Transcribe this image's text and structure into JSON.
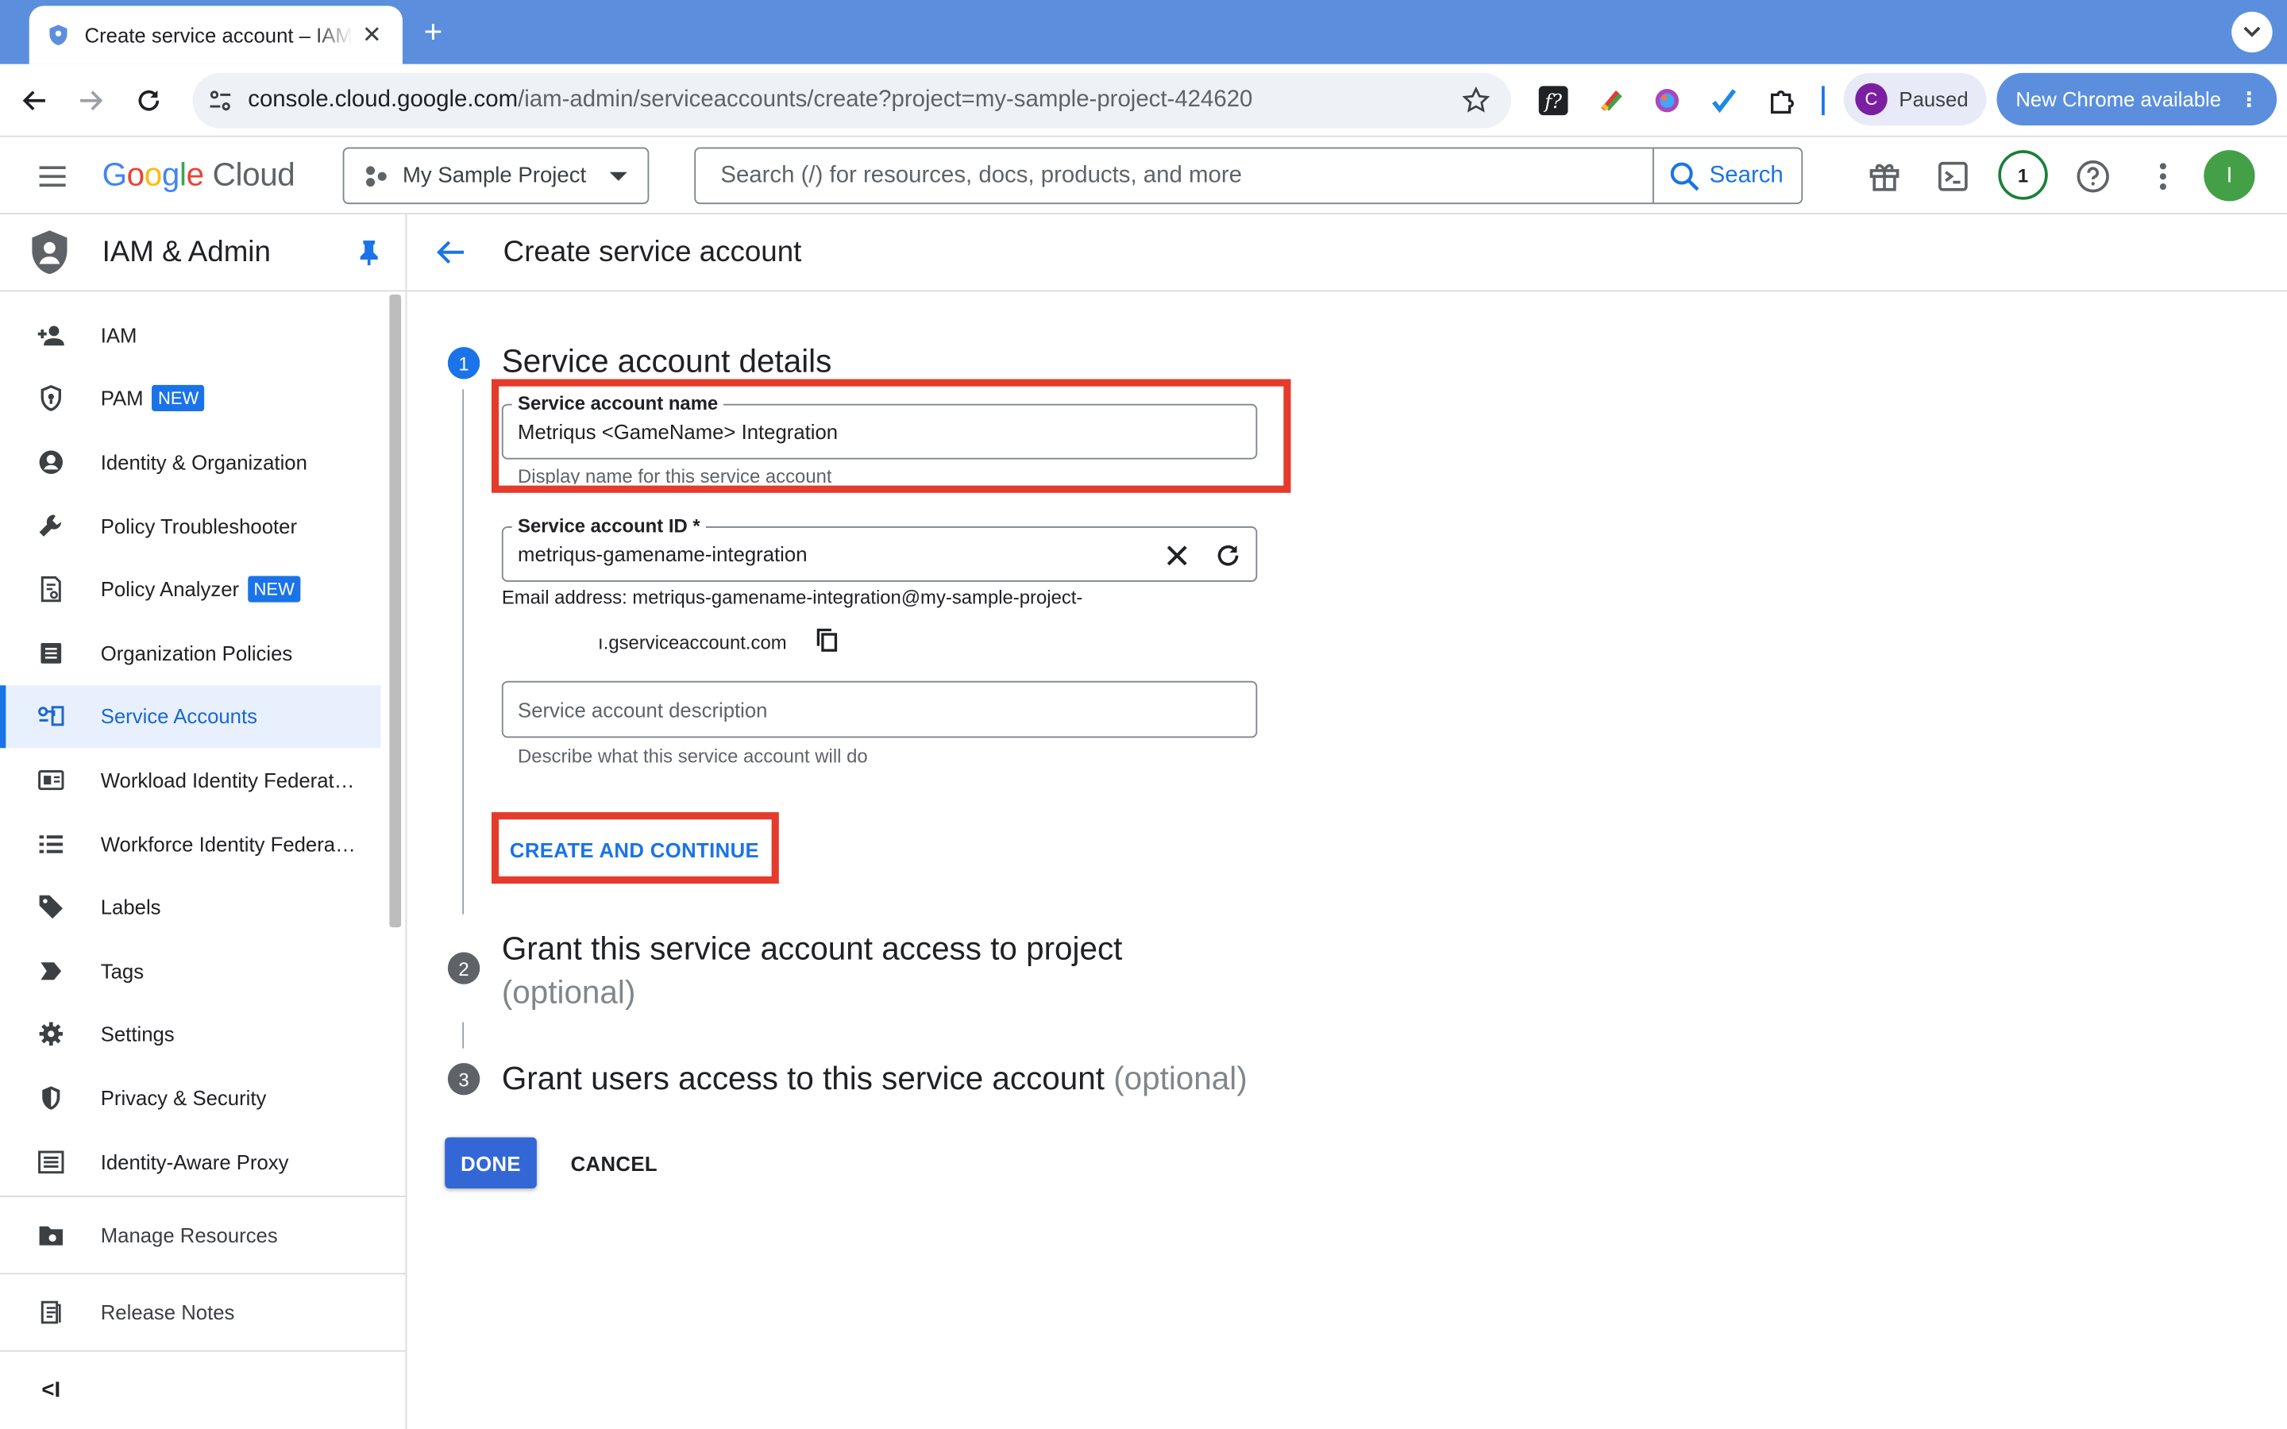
{
  "browser": {
    "tab_title": "Create service account – IAM & Admin",
    "url_host": "console.cloud.google.com",
    "url_path": "/iam-admin/serviceaccounts/create?project=my-sample-project-424620",
    "profile_initial": "C",
    "profile_label": "Paused",
    "update_label": "New Chrome available"
  },
  "header": {
    "logo_google": [
      "G",
      "o",
      "o",
      "g",
      "l",
      "e"
    ],
    "logo_cloud": "Cloud",
    "project_name": "My Sample Project",
    "search_placeholder": "Search (/) for resources, docs, products, and more",
    "search_button": "Search",
    "notification_count": "1",
    "user_initial": "I"
  },
  "sidebar": {
    "title": "IAM & Admin",
    "items": [
      {
        "label": "IAM",
        "icon": "person-add-icon"
      },
      {
        "label": "PAM",
        "badge": "NEW",
        "icon": "shield-key-icon"
      },
      {
        "label": "Identity & Organization",
        "icon": "account-circle-icon"
      },
      {
        "label": "Policy Troubleshooter",
        "icon": "wrench-icon"
      },
      {
        "label": "Policy Analyzer",
        "badge": "NEW",
        "icon": "document-search-icon"
      },
      {
        "label": "Organization Policies",
        "icon": "list-document-icon"
      },
      {
        "label": "Service Accounts",
        "icon": "service-account-icon",
        "active": true
      },
      {
        "label": "Workload Identity Federat…",
        "icon": "id-card-icon"
      },
      {
        "label": "Workforce Identity Federa…",
        "icon": "list-icon"
      },
      {
        "label": "Labels",
        "icon": "label-icon"
      },
      {
        "label": "Tags",
        "icon": "tag-icon"
      },
      {
        "label": "Settings",
        "icon": "gear-icon"
      },
      {
        "label": "Privacy & Security",
        "icon": "security-shield-icon"
      },
      {
        "label": "Identity-Aware Proxy",
        "icon": "proxy-icon"
      }
    ],
    "manage_resources": "Manage Resources",
    "release_notes": "Release Notes",
    "collapse_label": "<I"
  },
  "main": {
    "page_title": "Create service account",
    "step1": {
      "number": "1",
      "title": "Service account details",
      "name_label": "Service account name",
      "name_value": "Metriqus <GameName> Integration",
      "name_hint": "Display name for this service account",
      "id_label": "Service account ID *",
      "id_value": "metriqus-gamename-integration",
      "email_line1": "Email address: metriqus-gamename-integration@my-sample-project-",
      "email_line2": "ı.gserviceaccount.com",
      "description_placeholder": "Service account description",
      "description_hint": "Describe what this service account will do",
      "create_button": "CREATE AND CONTINUE"
    },
    "step2": {
      "number": "2",
      "title": "Grant this service account access to project",
      "optional": "(optional)"
    },
    "step3": {
      "number": "3",
      "title": "Grant users access to this service account",
      "optional": "(optional)"
    },
    "done_button": "DONE",
    "cancel_button": "CANCEL"
  },
  "colors": {
    "accent": "#1a73e8",
    "highlight_box": "#e53b2c",
    "chrome_blue": "#5b8fde",
    "done_button": "#3367d6"
  }
}
